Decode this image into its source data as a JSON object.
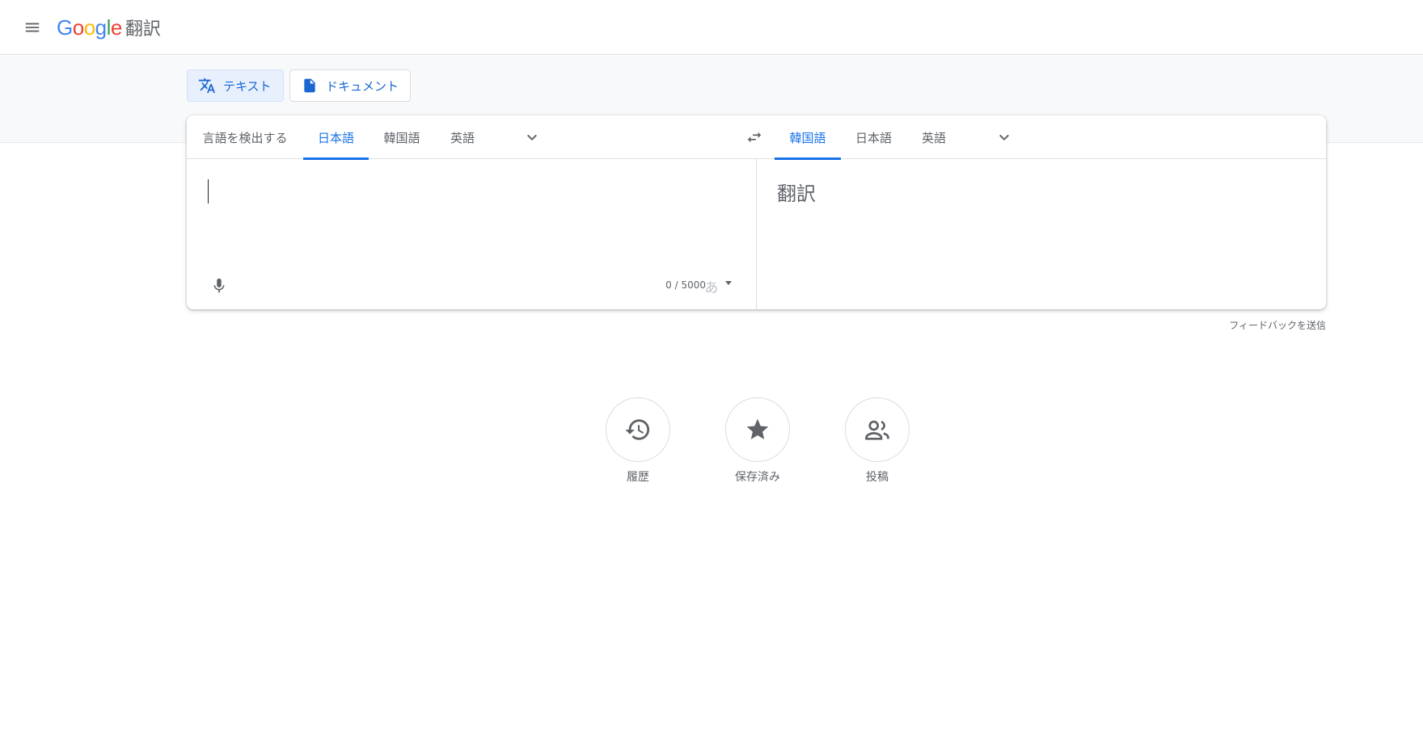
{
  "header": {
    "menu_icon": "hamburger-menu-icon",
    "logo_letters": [
      "G",
      "o",
      "o",
      "g",
      "l",
      "e"
    ],
    "logo_colors": [
      "#4285F4",
      "#EA4335",
      "#FBBC05",
      "#4285F4",
      "#34A853",
      "#EA4335"
    ],
    "product_name": "翻訳"
  },
  "modes": {
    "text_label": "テキスト",
    "text_icon": "translate-icon",
    "document_label": "ドキュメント",
    "document_icon": "document-icon"
  },
  "source_languages": {
    "detect": "言語を検出する",
    "items": [
      "日本語",
      "韓国語",
      "英語"
    ],
    "selected": "日本語",
    "more_icon": "chevron-down-icon"
  },
  "swap_icon": "swap-languages-icon",
  "target_languages": {
    "items": [
      "韓国語",
      "日本語",
      "英語"
    ],
    "selected": "韓国語",
    "more_icon": "chevron-down-icon"
  },
  "source": {
    "value": "",
    "char_count": "0 / 5000",
    "mic_icon": "microphone-icon",
    "ime_char": "あ"
  },
  "target": {
    "placeholder": "翻訳"
  },
  "feedback_label": "フィードバックを送信",
  "shortcuts": [
    {
      "label": "履歴",
      "icon": "history-icon"
    },
    {
      "label": "保存済み",
      "icon": "star-icon"
    },
    {
      "label": "投稿",
      "icon": "people-icon"
    }
  ],
  "colors": {
    "accent": "#1a73e8",
    "active_tab_bg": "#e8f0fe"
  }
}
